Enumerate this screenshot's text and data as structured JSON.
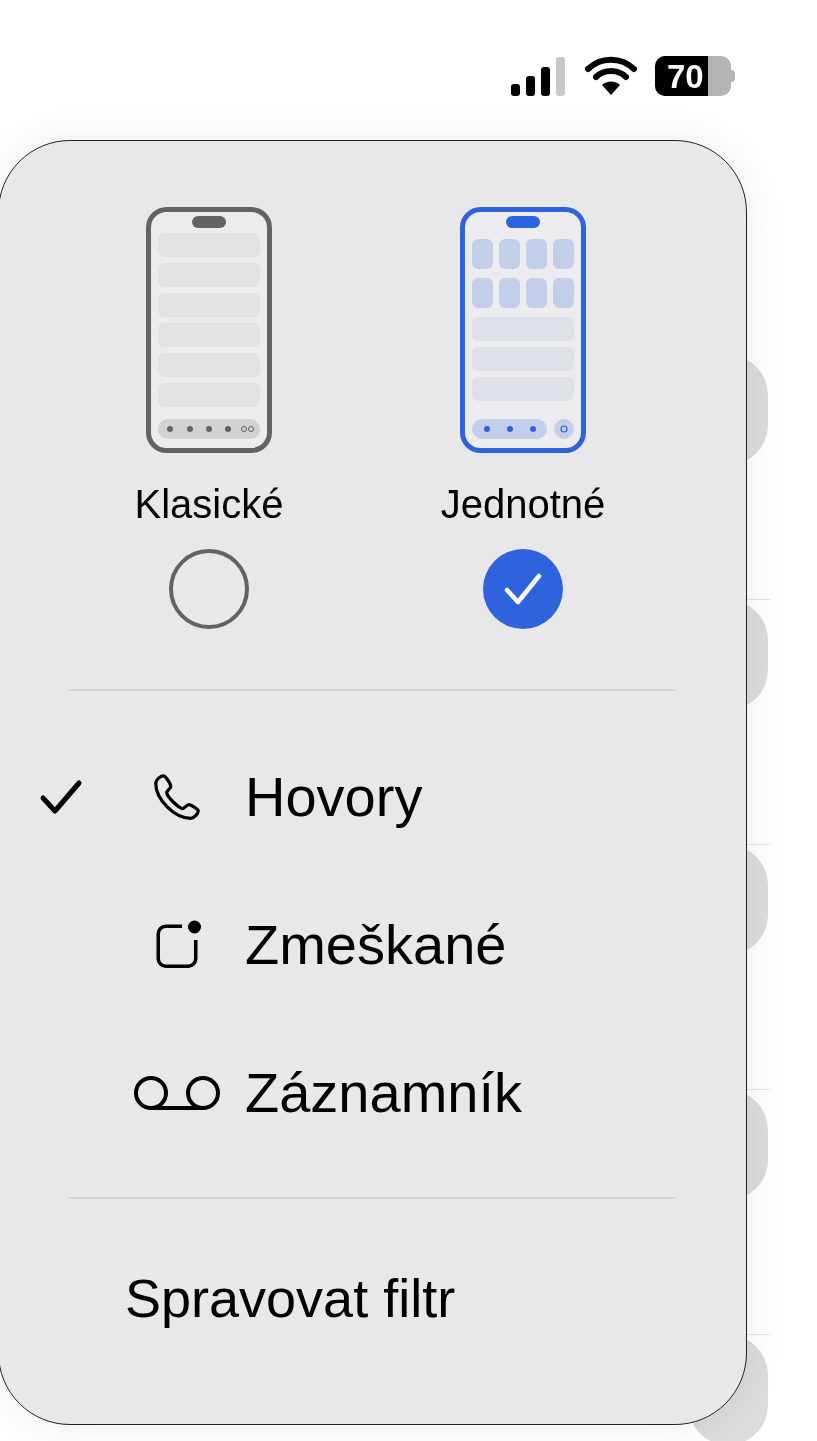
{
  "status_bar": {
    "battery": "70"
  },
  "layouts": [
    {
      "kind": "classic",
      "label": "Klasické",
      "selected": false
    },
    {
      "kind": "unified",
      "label": "Jednotné",
      "selected": true
    }
  ],
  "filters": [
    {
      "kind": "calls",
      "label": "Hovory",
      "selected": true
    },
    {
      "kind": "missed",
      "label": "Zmeškané",
      "selected": false
    },
    {
      "kind": "voicemail",
      "label": "Záznamník",
      "selected": false
    }
  ],
  "manage": "Spravovat filtr"
}
